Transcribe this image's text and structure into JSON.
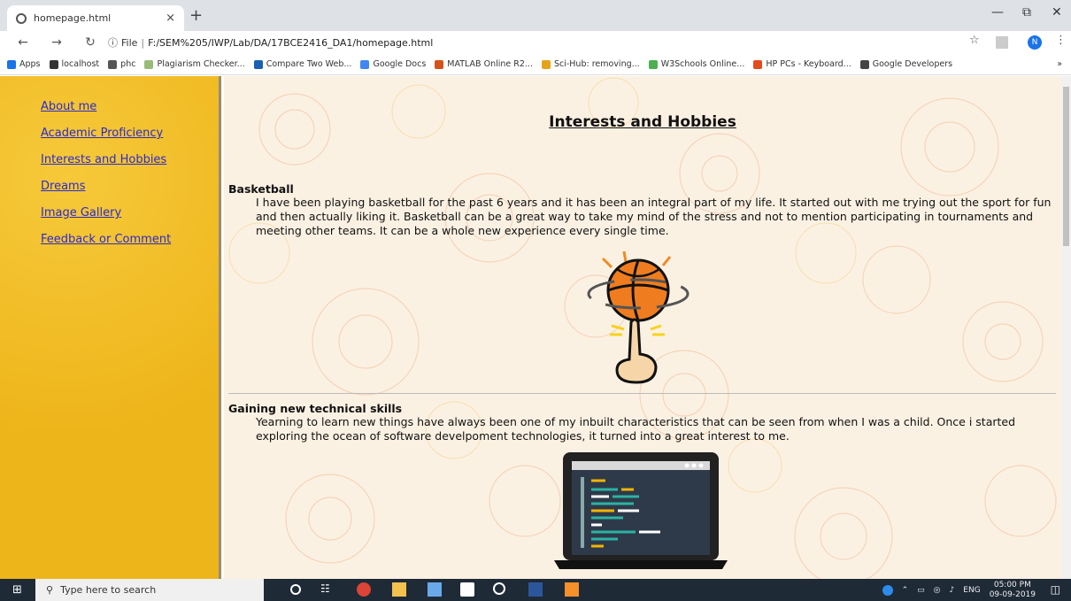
{
  "browser": {
    "tab_title": "homepage.html",
    "close_tab_glyph": "×",
    "new_tab_glyph": "+",
    "address_prefix": "File",
    "address_path": "F:/SEM%205/IWP/Lab/DA/17BCE2416_DA1/homepage.html",
    "profile_initial": "N"
  },
  "bookmarks": [
    {
      "label": "Apps",
      "icon": "apps-grid-icon",
      "color": "#1a73e8"
    },
    {
      "label": "localhost",
      "icon": "fork-knife-icon",
      "color": "#333"
    },
    {
      "label": "phc",
      "icon": "globe-icon",
      "color": "#555"
    },
    {
      "label": "Plagiarism Checker...",
      "icon": "sst-icon",
      "color": "#9b7"
    },
    {
      "label": "Compare Two Web...",
      "icon": "c-letter-icon",
      "color": "#1a5fb4"
    },
    {
      "label": "Google Docs",
      "icon": "docs-icon",
      "color": "#4285f4"
    },
    {
      "label": "MATLAB Online R2...",
      "icon": "matlab-icon",
      "color": "#d3531a"
    },
    {
      "label": "Sci-Hub: removing...",
      "icon": "scihub-icon",
      "color": "#e5a31b"
    },
    {
      "label": "W3Schools Online...",
      "icon": "w3-icon",
      "color": "#4caf50"
    },
    {
      "label": "HP PCs - Keyboard...",
      "icon": "hp-icon",
      "color": "#e24c1f"
    },
    {
      "label": "Google Developers",
      "icon": "code-brackets-icon",
      "color": "#444"
    }
  ],
  "bookmarks_overflow": "»",
  "sidebar": {
    "items": [
      {
        "label": "About me"
      },
      {
        "label": "Academic Proficiency"
      },
      {
        "label": "Interests and Hobbies"
      },
      {
        "label": "Dreams"
      },
      {
        "label": "Image Gallery"
      },
      {
        "label": "Feedback or Comment"
      }
    ]
  },
  "main": {
    "title": "Interests and Hobbies",
    "sections": [
      {
        "heading": "Basketball",
        "text": "I have been playing basketball for the past 6 years and it has been an integral part of my life. It started out with me trying out the sport for fun and then actually liking it. Basketball can be a great way to take my mind of the stress and not to mention participating in tournaments and meeting other teams. It can be a whole new experience every single time."
      },
      {
        "heading": "Gaining new technical skills",
        "text": "Yearning to learn new things have always been one of my inbuilt characteristics that can be seen from when I was a child. Once i started exploring the ocean of software develpoment technologies, it turned into a great interest to me."
      }
    ]
  },
  "taskbar": {
    "search_placeholder": "Type here to search",
    "language": "ENG",
    "time": "05:00 PM",
    "date": "09-09-2019"
  },
  "colors": {
    "sidebar_bg": "#f1bb1f",
    "link": "#2b2bcc",
    "main_bg": "#fbf1e3"
  }
}
